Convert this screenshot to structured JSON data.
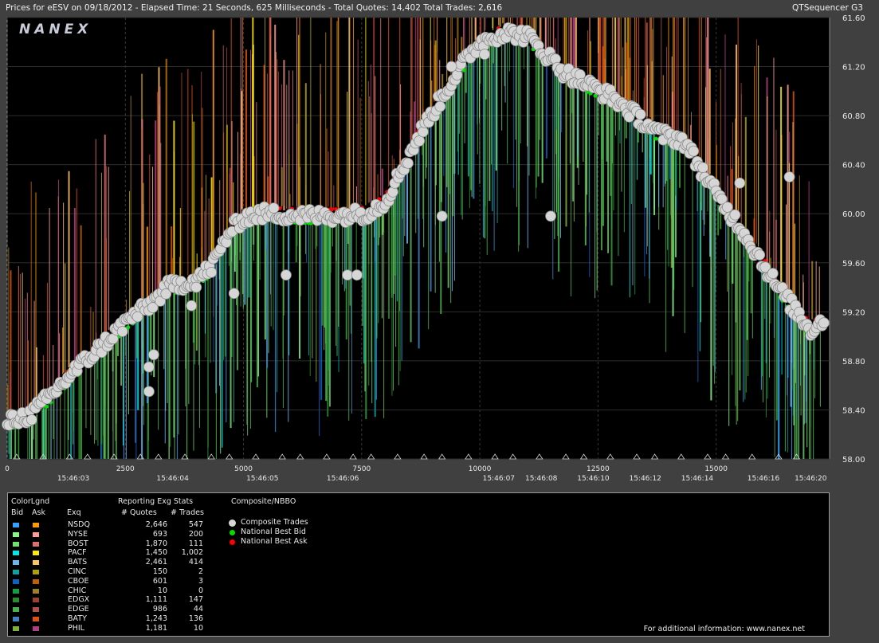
{
  "header": {
    "title_left": "Prices for  eESV  on  09/18/2012  -  Elapsed Time: 21 Seconds, 625 Milliseconds  -  Total Quotes: 14,402  Total Trades: 2,616",
    "title_right": "QTSequencer G3"
  },
  "logo": "NANEX",
  "footer_note": "For additional information: www.nanex.net",
  "colors": {
    "background": "#404040",
    "plot_bg": "#000000",
    "trade_marker": "#d6d6d6",
    "national_best_bid": "#00e000",
    "national_best_ask": "#ff0000"
  },
  "legend": {
    "color_legend_title": "ColorLgnd",
    "bid_label": "Bid",
    "ask_label": "Ask",
    "exq_label": "Exq",
    "stats_title": "Reporting Exg Stats",
    "quotes_header": "# Quotes",
    "trades_header": "# Trades",
    "composite_title": "Composite/NBBO",
    "composite_items": [
      {
        "label": "Composite Trades",
        "color": "#d6d6d6"
      },
      {
        "label": "National Best Bid",
        "color": "#00e000"
      },
      {
        "label": "National Best Ask",
        "color": "#ff0000"
      }
    ],
    "exchanges": [
      {
        "name": "NSDQ",
        "quotes": "2,646",
        "trades": "547",
        "bid_color": "#3aa0ff",
        "ask_color": "#ff9a00"
      },
      {
        "name": "NYSE",
        "quotes": "693",
        "trades": "200",
        "bid_color": "#8cf08c",
        "ask_color": "#ff9a9a"
      },
      {
        "name": "BOST",
        "quotes": "1,870",
        "trades": "111",
        "bid_color": "#70e070",
        "ask_color": "#e07070"
      },
      {
        "name": "PACF",
        "quotes": "1,450",
        "trades": "1,002",
        "bid_color": "#00e8e8",
        "ask_color": "#ffe800"
      },
      {
        "name": "BATS",
        "quotes": "2,461",
        "trades": "414",
        "bid_color": "#6ab4f0",
        "ask_color": "#ffc060"
      },
      {
        "name": "CINC",
        "quotes": "150",
        "trades": "2",
        "bid_color": "#10a0a0",
        "ask_color": "#b0a000"
      },
      {
        "name": "CBOE",
        "quotes": "601",
        "trades": "3",
        "bid_color": "#1060c0",
        "ask_color": "#c06000"
      },
      {
        "name": "CHIC",
        "quotes": "10",
        "trades": "0",
        "bid_color": "#10a040",
        "ask_color": "#a08020"
      },
      {
        "name": "EDGX",
        "quotes": "1,111",
        "trades": "147",
        "bid_color": "#2c8c2c",
        "ask_color": "#a04030"
      },
      {
        "name": "EDGE",
        "quotes": "986",
        "trades": "44",
        "bid_color": "#4cb04c",
        "ask_color": "#b05050"
      },
      {
        "name": "BATY",
        "quotes": "1,243",
        "trades": "136",
        "bid_color": "#4080c0",
        "ask_color": "#e05010"
      },
      {
        "name": "PHIL",
        "quotes": "1,181",
        "trades": "10",
        "bid_color": "#80b040",
        "ask_color": "#b04080"
      }
    ]
  },
  "chart_data": {
    "type": "scatter",
    "title": "Prices for  eESV  on  09/18/2012",
    "ylim": [
      58.0,
      61.6
    ],
    "xlim": [
      0,
      17400
    ],
    "y_ticks": [
      "61.60",
      "61.20",
      "60.80",
      "60.40",
      "60.00",
      "59.60",
      "59.20",
      "58.80",
      "58.40",
      "58.00"
    ],
    "x_ticks": [
      "0",
      "2500",
      "5000",
      "7500",
      "10000",
      "12500",
      "15000"
    ],
    "x_tick_values": [
      0,
      2500,
      5000,
      7500,
      10000,
      12500,
      15000
    ],
    "time_labels": [
      {
        "x": 1400,
        "label": "15:46:03"
      },
      {
        "x": 3500,
        "label": "15:46:04"
      },
      {
        "x": 5400,
        "label": "15:46:05"
      },
      {
        "x": 7100,
        "label": "15:46:06"
      },
      {
        "x": 10400,
        "label": "15:46:07"
      },
      {
        "x": 11300,
        "label": "15:46:08"
      },
      {
        "x": 12400,
        "label": "15:46:10"
      },
      {
        "x": 13500,
        "label": "15:46:12"
      },
      {
        "x": 14600,
        "label": "15:46:14"
      },
      {
        "x": 16000,
        "label": "15:46:16"
      },
      {
        "x": 17000,
        "label": "15:46:20"
      }
    ],
    "price_path": [
      [
        0,
        58.3
      ],
      [
        500,
        58.36
      ],
      [
        1000,
        58.55
      ],
      [
        1500,
        58.75
      ],
      [
        2000,
        58.92
      ],
      [
        2600,
        59.15
      ],
      [
        3000,
        59.25
      ],
      [
        3400,
        59.4
      ],
      [
        3900,
        59.45
      ],
      [
        4300,
        59.55
      ],
      [
        4700,
        59.85
      ],
      [
        5000,
        59.97
      ],
      [
        5400,
        60.0
      ],
      [
        6000,
        59.99
      ],
      [
        6600,
        59.98
      ],
      [
        7200,
        59.99
      ],
      [
        7600,
        60.0
      ],
      [
        8000,
        60.1
      ],
      [
        8400,
        60.4
      ],
      [
        8800,
        60.7
      ],
      [
        9200,
        60.95
      ],
      [
        9600,
        61.2
      ],
      [
        10000,
        61.4
      ],
      [
        10500,
        61.48
      ],
      [
        11000,
        61.45
      ],
      [
        11400,
        61.3
      ],
      [
        11800,
        61.15
      ],
      [
        12300,
        61.05
      ],
      [
        12800,
        60.95
      ],
      [
        13300,
        60.8
      ],
      [
        13800,
        60.65
      ],
      [
        14300,
        60.6
      ],
      [
        14700,
        60.35
      ],
      [
        15100,
        60.1
      ],
      [
        15500,
        59.9
      ],
      [
        15900,
        59.65
      ],
      [
        16300,
        59.4
      ],
      [
        16700,
        59.2
      ],
      [
        17000,
        59.05
      ],
      [
        17300,
        59.15
      ]
    ],
    "outlier_trades": [
      [
        3000,
        58.75
      ],
      [
        3000,
        58.55
      ],
      [
        3100,
        58.85
      ],
      [
        3900,
        59.25
      ],
      [
        4800,
        59.35
      ],
      [
        7200,
        59.5
      ],
      [
        7400,
        59.5
      ],
      [
        5900,
        59.5
      ],
      [
        9200,
        59.98
      ],
      [
        11500,
        59.98
      ],
      [
        15500,
        60.25
      ],
      [
        16550,
        60.3
      ],
      [
        9400,
        61.2
      ],
      [
        10100,
        61.3
      ],
      [
        4000,
        59.4
      ]
    ]
  }
}
